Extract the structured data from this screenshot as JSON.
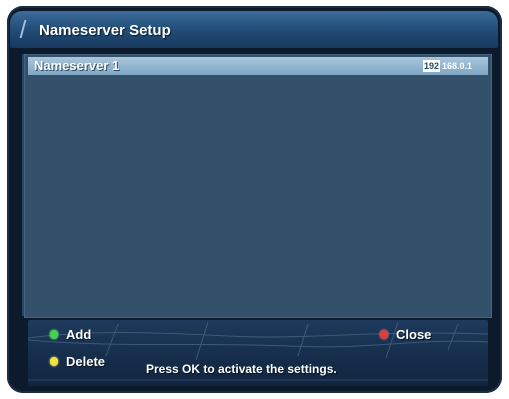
{
  "screen": {
    "title": "Nameserver Setup"
  },
  "nameservers": [
    {
      "label": "Nameserver 1",
      "value_selected": "192",
      "value_rest": "168.0.1"
    }
  ],
  "footer": {
    "add_label": "Add",
    "delete_label": "Delete",
    "close_label": "Close",
    "hint": "Press OK to activate the settings."
  },
  "colors": {
    "green_key": "#3fd44a",
    "yellow_key": "#f3e23a",
    "red_key": "#e33a3a",
    "selected_row": "#9abbd3",
    "panel": "#34516b"
  }
}
